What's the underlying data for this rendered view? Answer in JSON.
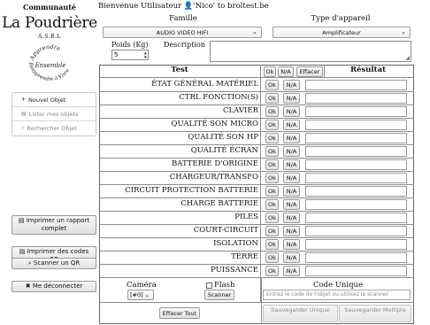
{
  "brand": {
    "top": "Communauté",
    "name": "La Poudrière",
    "asbl": "A.S.B.L",
    "emblem": {
      "line1": "Apprendre",
      "line2": "Ensemble",
      "line3": "Réapprendre à Vivre"
    }
  },
  "sidebar": {
    "items": [
      {
        "icon": "plus-icon",
        "glyph": "+",
        "label": "Nouvel Objet"
      },
      {
        "icon": "list-icon",
        "glyph": "▤",
        "label": "Lister mes objets"
      },
      {
        "icon": "search-icon",
        "glyph": "⌕",
        "label": "Rechercher Objet"
      }
    ],
    "print_report": {
      "glyph": "▤",
      "label": "Imprimer un rapport complet"
    },
    "print_qr": {
      "glyph": "▤",
      "label": "Imprimer des codes QR"
    },
    "scan_qr": {
      "glyph": "⌕",
      "label": "Scanner un QR"
    },
    "logout": {
      "glyph": "✖",
      "label": "Me déconnecter"
    }
  },
  "header": {
    "welcome": "Bienvenue Utilisateur 👤'Nico' to broltest.be"
  },
  "form": {
    "famille_label": "Famille",
    "famille_value": "AUDIO VIDEO HIFI",
    "type_label": "Type d'appareil",
    "type_value": "Amplificateur",
    "poids_label": "Poids (Kg)",
    "poids_value": "5",
    "description_label": "Description"
  },
  "table": {
    "header_test": "Test",
    "header_ok": "Ok",
    "header_na": "N/A",
    "header_clear": "Effacer",
    "header_result": "Résultat",
    "ok_label": "Ok",
    "na_label": "N/A",
    "rows": [
      "ÉTAT GÉNÉRAL MATÉRIEL",
      "CTRL FONCTION(S)",
      "CLAVIER",
      "QUALITÉ SON MICRO",
      "QUALITÉ SON HP",
      "QUALITÉ ÉCRAN",
      "BATTERIE D'ORIGINE",
      "CHARGEUR/TRANSFO",
      "CIRCUIT PROTECTION BATTERIE",
      "CHARGE BATTERIE",
      "PILES",
      "COURT-CIRCUIT",
      "ISOLATION",
      "TERRE",
      "PUISSANCE"
    ]
  },
  "bottom": {
    "camera_label": "Caméra",
    "camera_value": "[#0]",
    "flash_label": "Flash",
    "scanner_label": "Scanner",
    "code_label": "Code Unique",
    "code_placeholder": "Entrez le code de l'objet ou utilisez le scanner",
    "effacer_tout": "Effacer Tout",
    "save_unique": "Sauvegarder Unique",
    "save_multiple": "Sauvegarder Multiple"
  }
}
